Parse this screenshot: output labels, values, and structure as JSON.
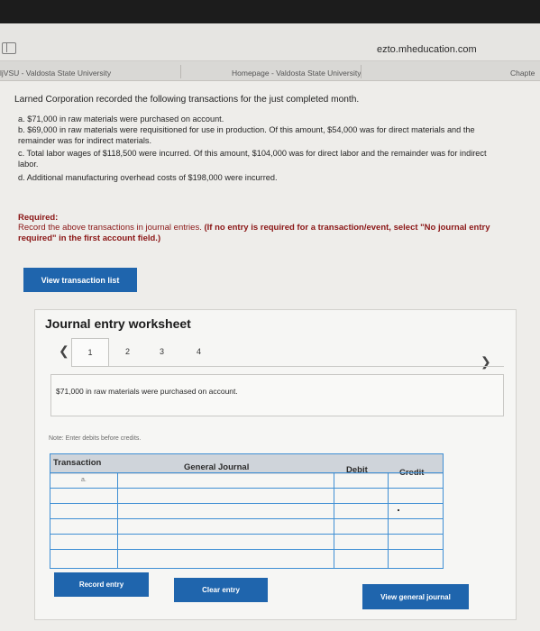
{
  "browser": {
    "url": "ezto.mheducation.com",
    "tabs": [
      "ljVSU - Valdosta State University",
      "Homepage - Valdosta State University",
      "Chapte"
    ]
  },
  "problem": {
    "intro": "Larned Corporation recorded the following transactions for the just completed month.",
    "items": [
      "a. $71,000 in raw materials were purchased on account.",
      "b. $69,000 in raw materials were requisitioned for use in production. Of this amount, $54,000 was for direct materials and the remainder was for indirect materials.",
      "c. Total labor wages of $118,500 were incurred. Of this amount, $104,000 was for direct labor and the remainder was for indirect labor.",
      "d. Additional manufacturing overhead costs of $198,000 were incurred."
    ],
    "required_label": "Required:",
    "required_text": "Record the above transactions in journal entries.",
    "required_note": "(If no entry is required for a transaction/event, select \"No journal entry required\" in the first account field.)"
  },
  "buttons": {
    "view_transaction_list": "View transaction list",
    "record_entry": "Record entry",
    "clear_entry": "Clear entry",
    "view_general_journal": "View general journal"
  },
  "worksheet": {
    "title": "Journal entry worksheet",
    "pages": [
      "1",
      "2",
      "3",
      "4"
    ],
    "active_page": "1",
    "description": "$71,000 in raw materials were purchased on account.",
    "note": "Note: Enter debits before credits.",
    "columns": [
      "Transaction",
      "General Journal",
      "Debit",
      "Credit"
    ],
    "first_row_label": "a."
  },
  "colors": {
    "primary_button": "#1f65ad",
    "required_text": "#8a1515",
    "grid_border": "#3f8fd4"
  }
}
